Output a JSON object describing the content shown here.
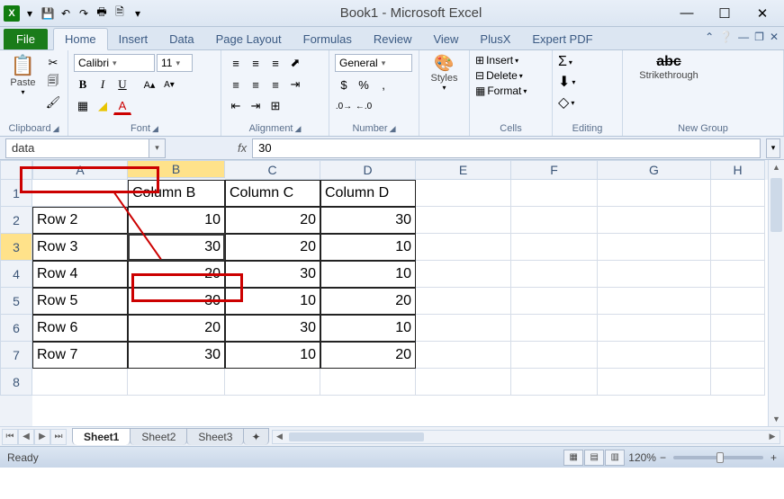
{
  "title": "Book1 - Microsoft Excel",
  "tabs": {
    "file": "File",
    "list": [
      "Home",
      "Insert",
      "Data",
      "Page Layout",
      "Formulas",
      "Review",
      "View",
      "PlusX",
      "Expert PDF"
    ],
    "active": "Home"
  },
  "ribbon": {
    "clipboard": {
      "label": "Clipboard",
      "paste": "Paste"
    },
    "font": {
      "label": "Font",
      "family": "Calibri",
      "size": "11"
    },
    "alignment": {
      "label": "Alignment"
    },
    "number": {
      "label": "Number",
      "format": "General"
    },
    "styles": {
      "label": "Styles"
    },
    "cells": {
      "label": "Cells",
      "insert": "Insert",
      "delete": "Delete",
      "format": "Format"
    },
    "editing": {
      "label": "Editing"
    },
    "newgroup": {
      "label": "New Group",
      "strike": "Strikethrough"
    }
  },
  "namebox": "data",
  "formula": "30",
  "columns": [
    "A",
    "B",
    "C",
    "D",
    "E",
    "F",
    "G",
    "H"
  ],
  "rows": [
    "1",
    "2",
    "3",
    "4",
    "5",
    "6",
    "7",
    "8"
  ],
  "active_cell": {
    "row": 3,
    "col": "B"
  },
  "grid": {
    "headers": [
      "",
      "Column B",
      "Column C",
      "Column D"
    ],
    "data": [
      {
        "label": "Row 2",
        "b": "10",
        "c": "20",
        "d": "30"
      },
      {
        "label": "Row 3",
        "b": "30",
        "c": "20",
        "d": "10"
      },
      {
        "label": "Row 4",
        "b": "20",
        "c": "30",
        "d": "10"
      },
      {
        "label": "Row 5",
        "b": "30",
        "c": "10",
        "d": "20"
      },
      {
        "label": "Row 6",
        "b": "20",
        "c": "30",
        "d": "10"
      },
      {
        "label": "Row 7",
        "b": "30",
        "c": "10",
        "d": "20"
      }
    ]
  },
  "sheets": {
    "list": [
      "Sheet1",
      "Sheet2",
      "Sheet3"
    ],
    "active": "Sheet1"
  },
  "status": {
    "ready": "Ready",
    "zoom": "120%"
  },
  "chart_data": {
    "type": "table",
    "categories": [
      "Row 2",
      "Row 3",
      "Row 4",
      "Row 5",
      "Row 6",
      "Row 7"
    ],
    "series": [
      {
        "name": "Column B",
        "values": [
          10,
          30,
          20,
          30,
          20,
          30
        ]
      },
      {
        "name": "Column C",
        "values": [
          20,
          20,
          30,
          10,
          30,
          10
        ]
      },
      {
        "name": "Column D",
        "values": [
          30,
          10,
          10,
          20,
          10,
          20
        ]
      }
    ],
    "title": "data"
  }
}
